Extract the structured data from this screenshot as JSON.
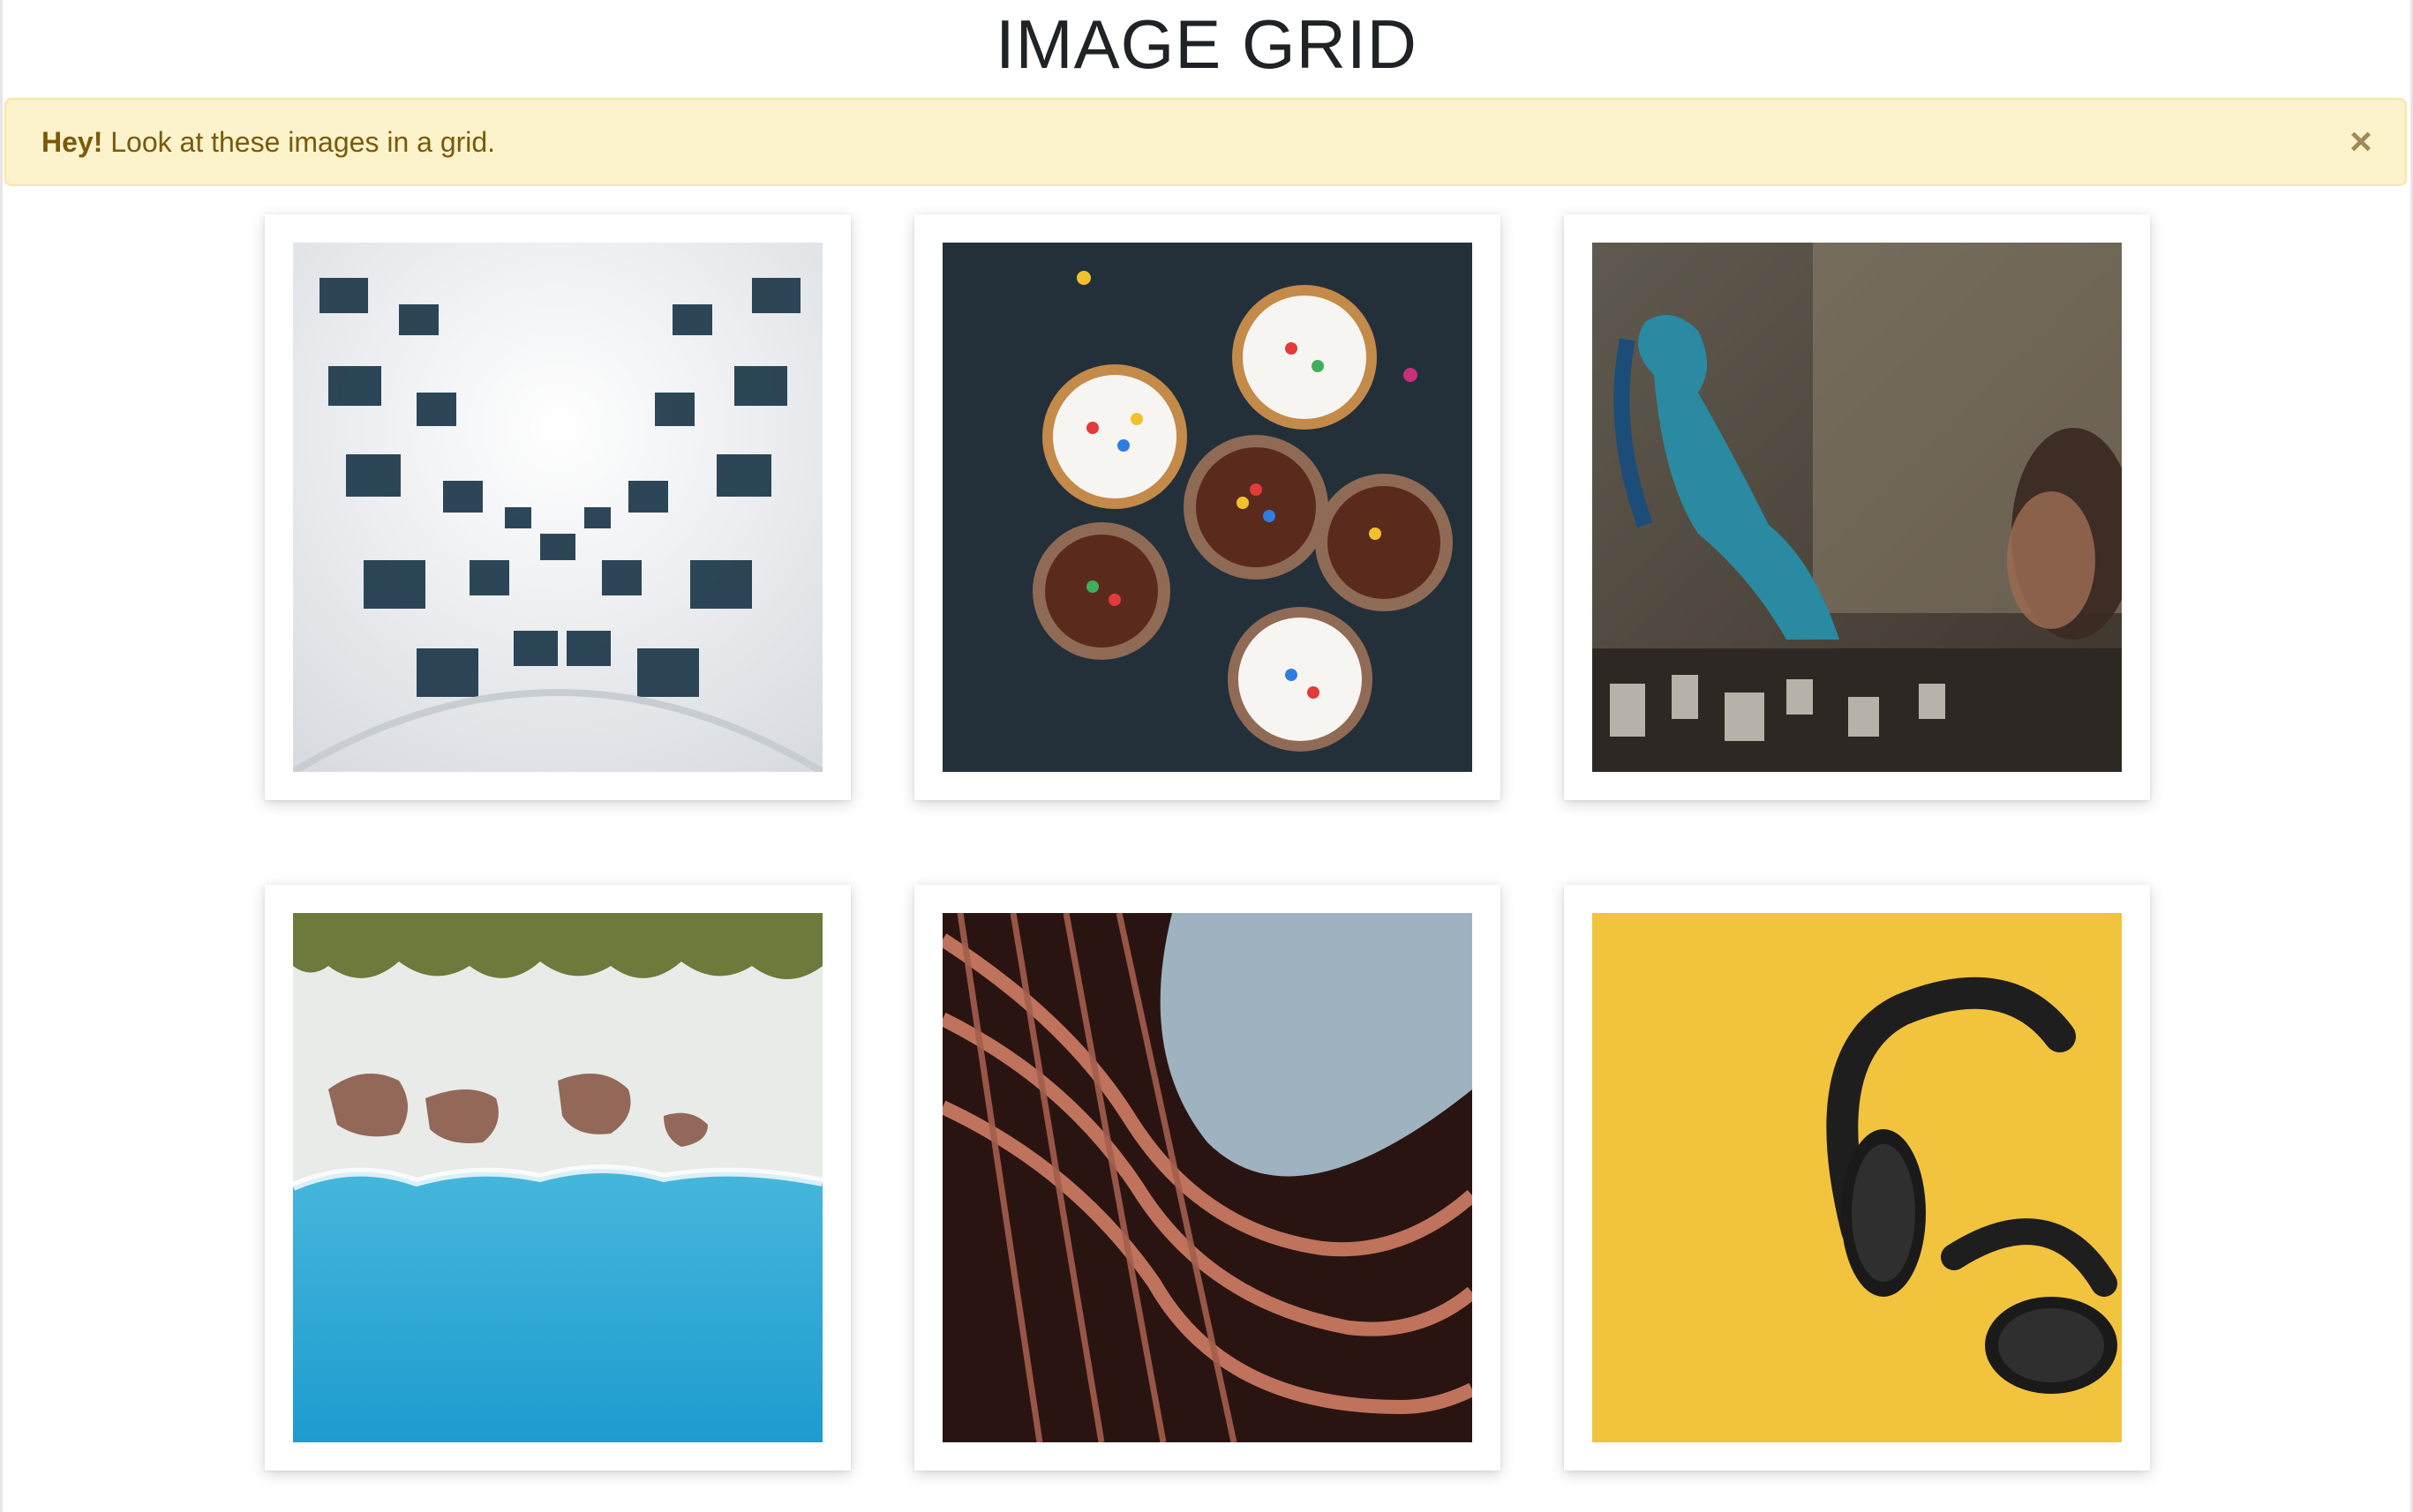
{
  "page": {
    "title": "IMAGE GRID"
  },
  "alert": {
    "strong": "Hey!",
    "message": " Look at these images in a grid.",
    "close_icon": "close-icon"
  },
  "images": [
    {
      "name": "image-building-upward-windows",
      "icon": "photo-icon"
    },
    {
      "name": "image-cupcakes-sprinkles",
      "icon": "photo-icon"
    },
    {
      "name": "image-graffiti-wall-woman",
      "icon": "photo-icon"
    },
    {
      "name": "image-aerial-beach-ocean",
      "icon": "photo-icon"
    },
    {
      "name": "image-curved-building-facade",
      "icon": "photo-icon"
    },
    {
      "name": "image-headphones-yellow",
      "icon": "photo-icon"
    }
  ],
  "colors": {
    "alert_bg": "#fcf2cc",
    "alert_text": "#7a5a09",
    "card_bg": "#ffffff",
    "headphones_bg": "#f2c33d"
  }
}
